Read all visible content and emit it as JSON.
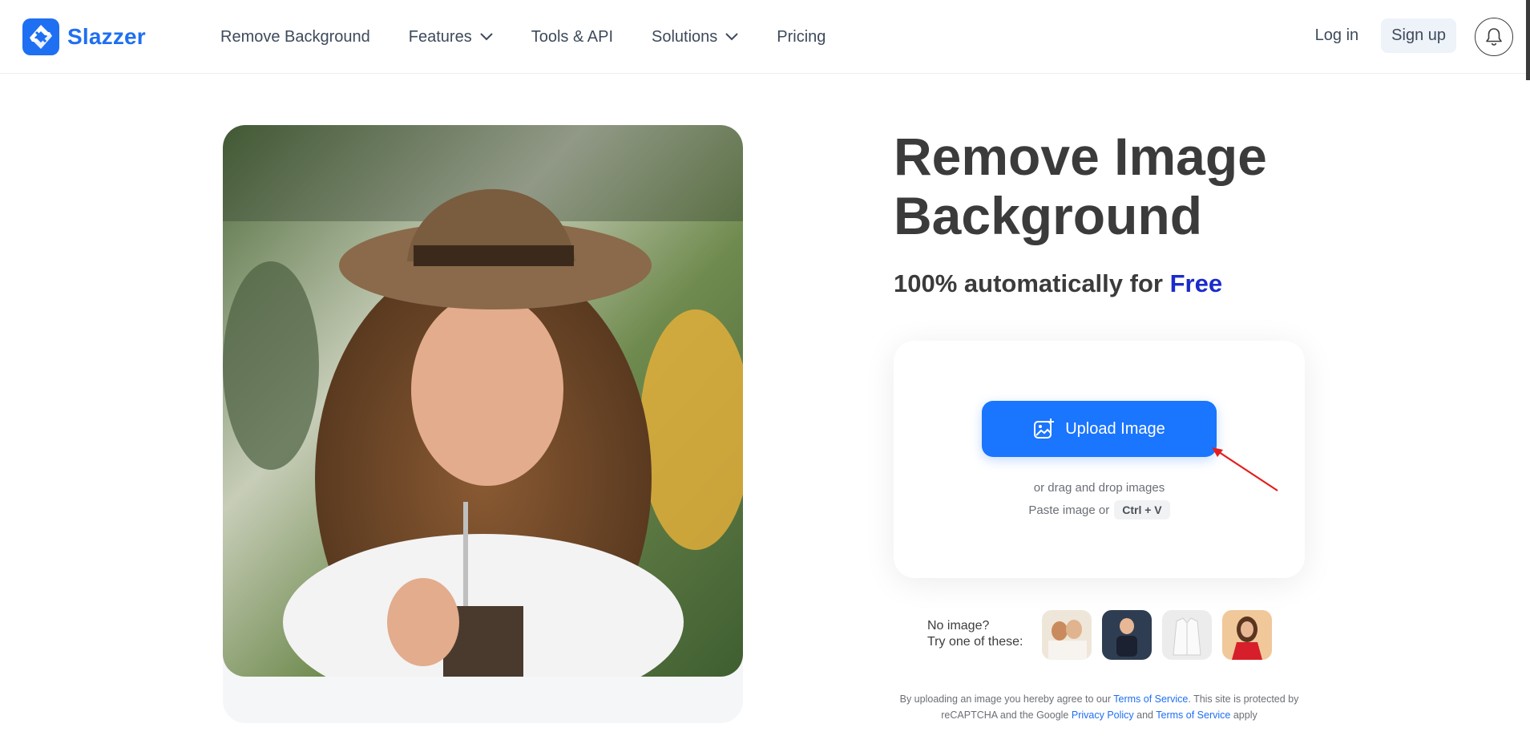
{
  "brand": {
    "name": "Slazzer",
    "color": "#1f6ff2",
    "icon": "slazzer-logo-icon"
  },
  "nav": {
    "items": [
      {
        "label": "Remove Background",
        "has_dropdown": false
      },
      {
        "label": "Features",
        "has_dropdown": true
      },
      {
        "label": "Tools & API",
        "has_dropdown": false
      },
      {
        "label": "Solutions",
        "has_dropdown": true
      },
      {
        "label": "Pricing",
        "has_dropdown": false
      }
    ]
  },
  "auth": {
    "login_label": "Log in",
    "signup_label": "Sign up",
    "bell_icon": "bell-icon"
  },
  "hero": {
    "title": "Remove Image Background",
    "subtitle_prefix": "100% automatically for",
    "subtitle_highlight": "Free",
    "highlight_color": "#1a2bcc"
  },
  "upload": {
    "button_label": "Upload Image",
    "button_icon": "image-plus-icon",
    "button_color": "#1a75ff",
    "drag_text": "or drag and drop images",
    "paste_text": "Paste image or",
    "shortcut": "Ctrl + V"
  },
  "samples": {
    "line1": "No image?",
    "line2": "Try one of these:",
    "thumbnails": [
      "sample-couple",
      "sample-child",
      "sample-shirt",
      "sample-woman-red"
    ]
  },
  "terms": {
    "part1": "By uploading an image you hereby agree to our",
    "link1": "Terms of Service",
    "part2": ". This site is protected by reCAPTCHA and the Google",
    "link2": "Privacy Policy",
    "part3": "and",
    "link3": "Terms of Service",
    "part4": "apply"
  }
}
